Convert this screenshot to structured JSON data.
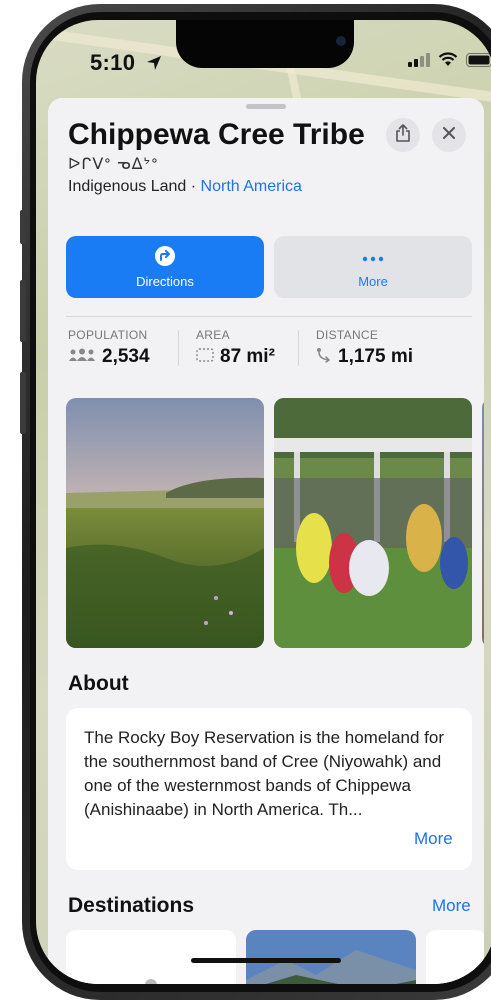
{
  "status": {
    "time": "5:10"
  },
  "place": {
    "title": "Chippewa Cree Tribe",
    "native_name": "ᐅᒋᐯᐤ ᓀᐃᔾᐤ",
    "category": "Indigenous Land",
    "separator": " · ",
    "region": "North America"
  },
  "actions": {
    "directions": "Directions",
    "more": "More"
  },
  "stats": [
    {
      "label": "POPULATION",
      "value": "2,534",
      "icon": "people-icon"
    },
    {
      "label": "AREA",
      "value": "87 mi²",
      "icon": "area-icon"
    },
    {
      "label": "DISTANCE",
      "value": "1,175 mi",
      "icon": "distance-icon"
    }
  ],
  "about": {
    "heading": "About",
    "text": "The Rocky Boy Reservation is the homeland for the southernmost band of Cree (Niyowahk) and one of the westernmost bands of Chippewa (Anishinaabe) in North America. Th...",
    "more": "More"
  },
  "destinations": {
    "heading": "Destinations",
    "more": "More"
  },
  "colors": {
    "accent": "#1a7cf5",
    "sheet": "#f2f2f4"
  }
}
